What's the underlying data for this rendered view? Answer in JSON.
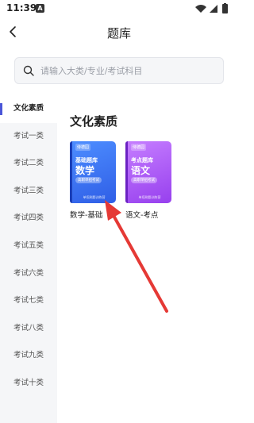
{
  "status_bar": {
    "time": "11:39",
    "notification_letter": "A"
  },
  "header": {
    "title": "题库"
  },
  "search": {
    "value": "",
    "placeholder": "请输入大类/专业/考试科目"
  },
  "sidebar": {
    "items": [
      {
        "label": "文化素质",
        "active": true
      },
      {
        "label": "考试一类",
        "active": false
      },
      {
        "label": "考试二类",
        "active": false
      },
      {
        "label": "考试三类",
        "active": false
      },
      {
        "label": "考试四类",
        "active": false
      },
      {
        "label": "考试五类",
        "active": false
      },
      {
        "label": "考试六类",
        "active": false
      },
      {
        "label": "考试七类",
        "active": false
      },
      {
        "label": "考试八类",
        "active": false
      },
      {
        "label": "考试九类",
        "active": false
      },
      {
        "label": "考试十类",
        "active": false
      }
    ]
  },
  "main": {
    "section_title": "文化素质",
    "books": [
      {
        "brand": "侍德园",
        "series": "基础题库",
        "subject": "数学",
        "tag": "高职单招考试",
        "footer": "单招刷题训练营",
        "caption": "数学-基础"
      },
      {
        "brand": "侍德园",
        "series": "考点题库",
        "subject": "语文",
        "tag": "高职单招考试",
        "footer": "单招刷题训练营",
        "caption": "语文-考点"
      }
    ]
  },
  "colors": {
    "accent": "#4a56d8",
    "sidebar_bg": "#f5f6f8",
    "book_blue": "#2f5ee6",
    "book_purple": "#9740ee",
    "annotation_arrow": "#e53935"
  },
  "icons": {
    "back": "chevron-left-icon",
    "search": "search-icon",
    "wifi": "wifi-icon",
    "signal": "signal-icon",
    "battery": "battery-icon"
  }
}
